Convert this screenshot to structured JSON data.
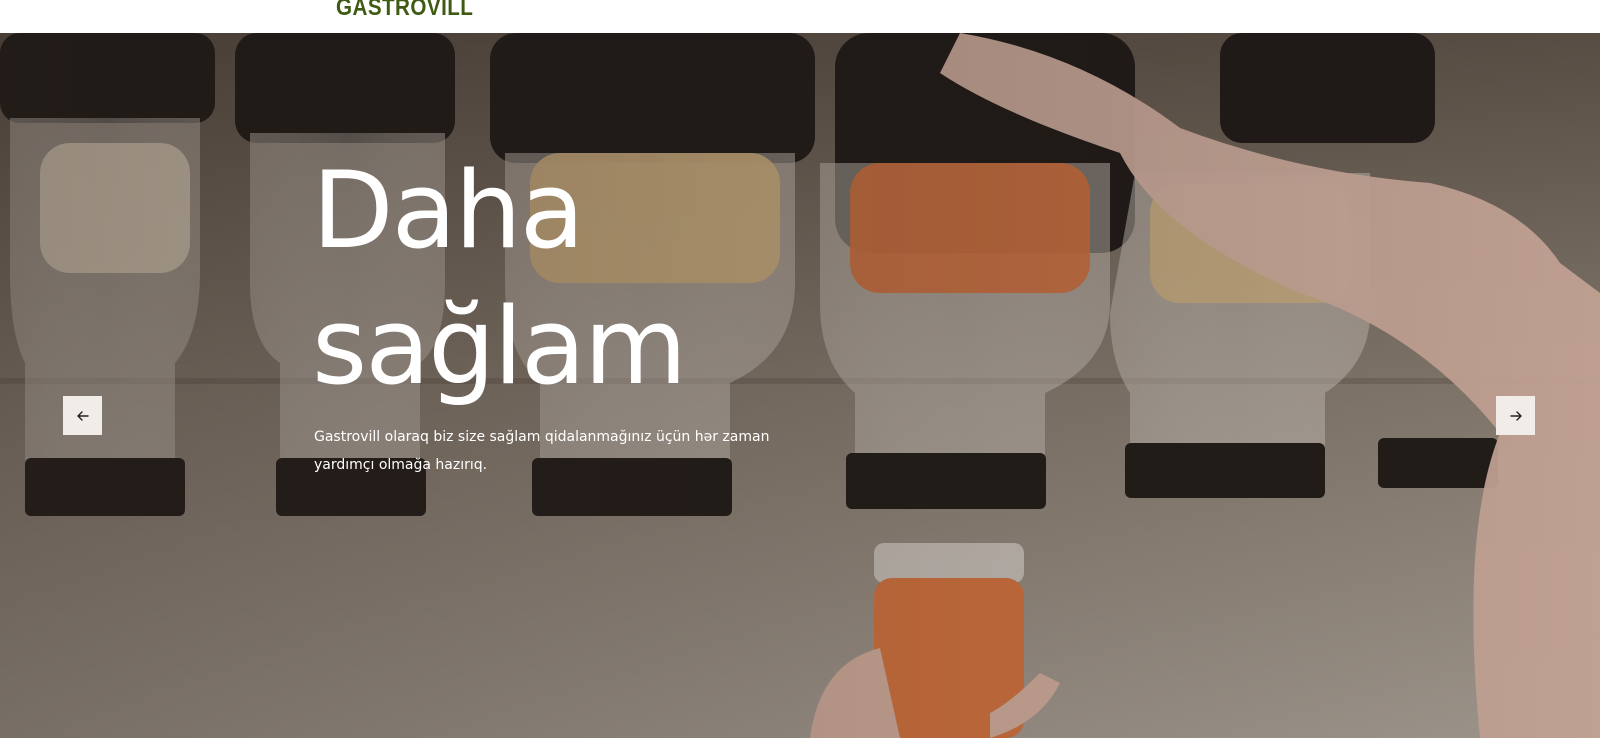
{
  "header": {
    "logo_text": "GASTROVILL"
  },
  "hero": {
    "title_line1": "Daha",
    "title_line2": "sağlam",
    "description_line1": "Gastrovill olaraq biz size sağlam qidalanmağınız üçün hər zaman",
    "description_line2": "yardımçı olmağa hazırıq.",
    "prev_icon": "arrow-left-icon",
    "next_icon": "arrow-right-icon"
  },
  "colors": {
    "brand_green": "#3f5a12",
    "arrow_bg": "#f1ece8"
  }
}
